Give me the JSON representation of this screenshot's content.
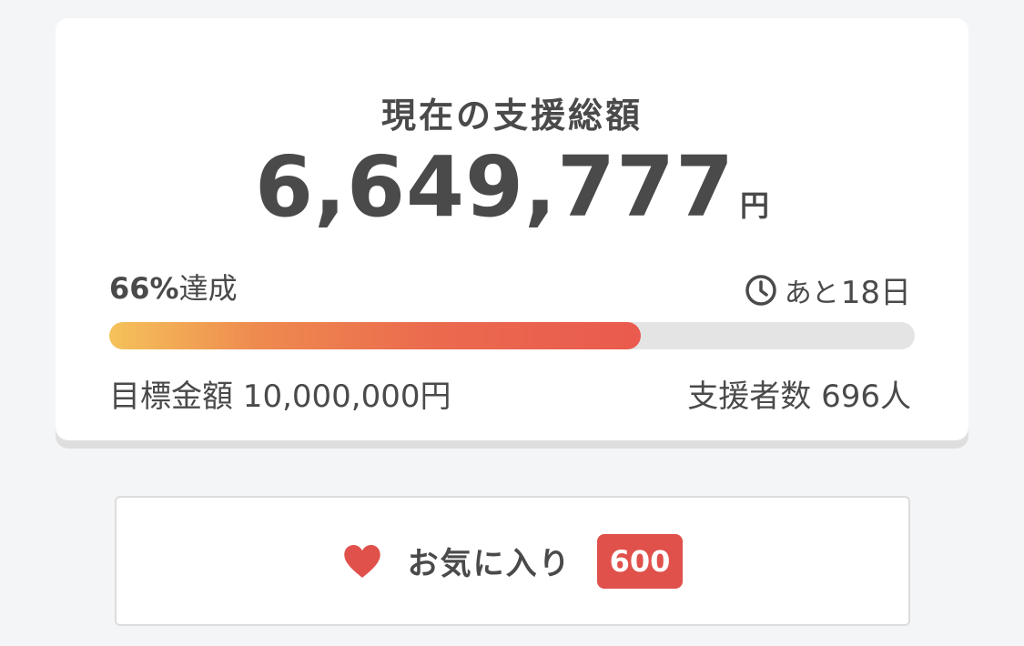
{
  "funding": {
    "title": "現在の支援総額",
    "amount": "6,649,777",
    "amount_unit": "円",
    "achieved_percent": "66%",
    "achieved_label": "達成",
    "progress": 0.66,
    "remaining_prefix": "あと",
    "remaining_value": "18日",
    "goal_text": "目標金額 10,000,000円",
    "supporters_text": "支援者数 696人"
  },
  "favorite": {
    "label": "お気に入り",
    "count": "600"
  },
  "colors": {
    "background": "#f4f5f7",
    "text": "#4a4a4a",
    "progress_start": "#f5c25a",
    "progress_end": "#ea5a4e",
    "progress_track": "#e4e4e4",
    "accent_red": "#e0514b"
  },
  "icons": {
    "clock": "clock-icon",
    "heart": "heart-icon"
  }
}
